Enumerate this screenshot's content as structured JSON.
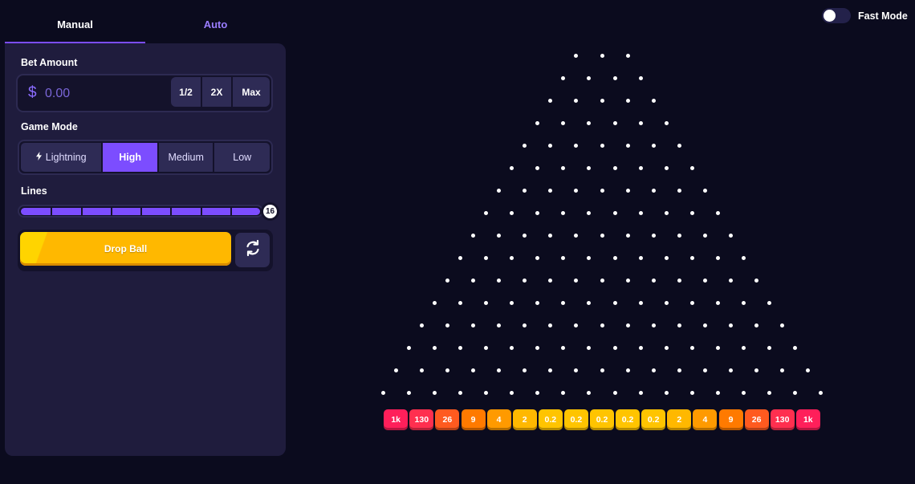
{
  "tabs": [
    {
      "label": "Manual",
      "active": true
    },
    {
      "label": "Auto",
      "active": false
    }
  ],
  "bet": {
    "label": "Bet Amount",
    "currency_symbol": "$",
    "placeholder": "0.00",
    "value": "",
    "buttons": {
      "half": "1/2",
      "double": "2X",
      "max": "Max"
    }
  },
  "game_mode": {
    "label": "Game Mode",
    "options": [
      "Lightning",
      "High",
      "Medium",
      "Low"
    ],
    "selected": "High"
  },
  "lines": {
    "label": "Lines",
    "value": "16",
    "fill_fraction": 1.0
  },
  "drop_button": {
    "label": "Drop Ball"
  },
  "fast_mode": {
    "label": "Fast Mode",
    "enabled": false
  },
  "board": {
    "peg_rows": 16,
    "first_row_pegs": 3
  },
  "multipliers": [
    "1k",
    "130",
    "26",
    "9",
    "4",
    "2",
    "0.2",
    "0.2",
    "0.2",
    "0.2",
    "0.2",
    "2",
    "4",
    "9",
    "26",
    "130",
    "1k"
  ],
  "colors": {
    "background": "#0b0b1e",
    "panel": "#1f1c3d",
    "accent": "#7c4dff",
    "drop_button": "#ffb800",
    "bucket_palette": [
      "#ff1f5a",
      "#ff2f4f",
      "#ff5a1f",
      "#ff7a00",
      "#ff9a00",
      "#ffb800",
      "#ffc400"
    ]
  },
  "icons": {
    "lightning": "lightning-icon",
    "auto_bet": "auto-refresh-icon"
  }
}
